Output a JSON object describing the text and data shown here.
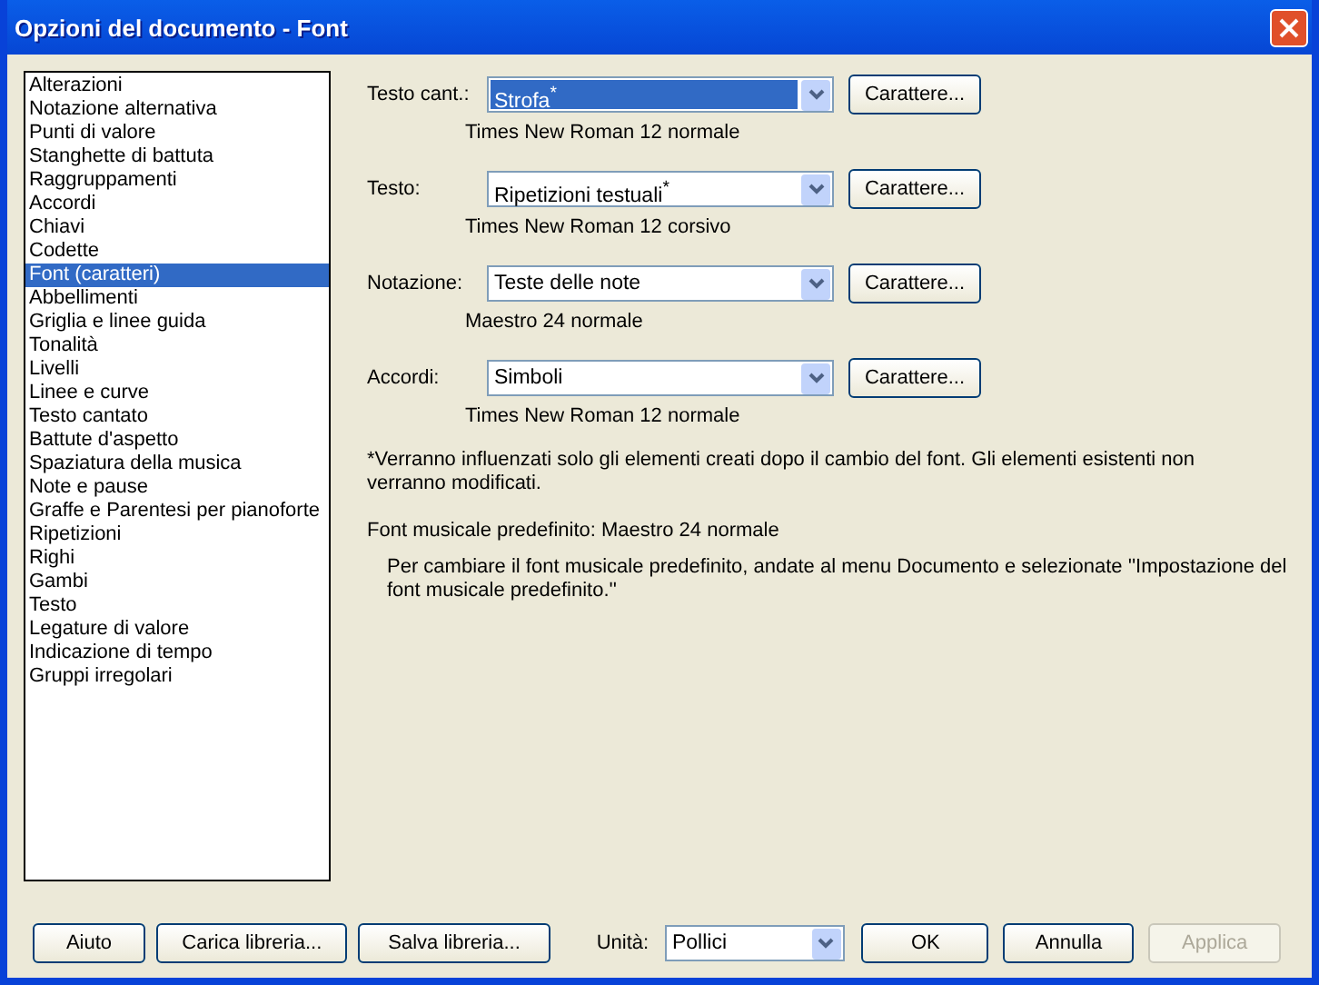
{
  "window": {
    "title": "Opzioni del documento - Font"
  },
  "sidebar": {
    "items": [
      {
        "label": "Alterazioni",
        "selected": false
      },
      {
        "label": "Notazione alternativa",
        "selected": false
      },
      {
        "label": "Punti di valore",
        "selected": false
      },
      {
        "label": "Stanghette di battuta",
        "selected": false
      },
      {
        "label": "Raggruppamenti",
        "selected": false
      },
      {
        "label": "Accordi",
        "selected": false
      },
      {
        "label": "Chiavi",
        "selected": false
      },
      {
        "label": "Codette",
        "selected": false
      },
      {
        "label": "Font (caratteri)",
        "selected": true
      },
      {
        "label": "Abbellimenti",
        "selected": false
      },
      {
        "label": "Griglia e linee guida",
        "selected": false
      },
      {
        "label": "Tonalità",
        "selected": false
      },
      {
        "label": "Livelli",
        "selected": false
      },
      {
        "label": "Linee e curve",
        "selected": false
      },
      {
        "label": "Testo cantato",
        "selected": false
      },
      {
        "label": "Battute d'aspetto",
        "selected": false
      },
      {
        "label": "Spaziatura della musica",
        "selected": false
      },
      {
        "label": "Note e pause",
        "selected": false
      },
      {
        "label": "Graffe e Parentesi per pianoforte",
        "selected": false
      },
      {
        "label": "Ripetizioni",
        "selected": false
      },
      {
        "label": "Righi",
        "selected": false
      },
      {
        "label": "Gambi",
        "selected": false
      },
      {
        "label": "Testo",
        "selected": false
      },
      {
        "label": "Legature di valore",
        "selected": false
      },
      {
        "label": "Indicazione di tempo",
        "selected": false
      },
      {
        "label": "Gruppi irregolari",
        "selected": false
      }
    ]
  },
  "font_rows": [
    {
      "label": "Testo cant.:",
      "value": "Strofa$^{*}$",
      "focused": true,
      "button": "Carattere...",
      "font": "Times New Roman 12 normale"
    },
    {
      "label": "Testo:",
      "value": "Ripetizioni testuali$^{*}$",
      "focused": false,
      "button": "Carattere...",
      "font": "Times New Roman 12 corsivo"
    },
    {
      "label": "Notazione:",
      "value": "Teste delle note",
      "focused": false,
      "button": "Carattere...",
      "font": "Maestro 24 normale"
    },
    {
      "label": "Accordi:",
      "value": "Simboli",
      "focused": false,
      "button": "Carattere...",
      "font": "Times New Roman 12 normale"
    }
  ],
  "note": "*Verranno influenzati solo gli elementi creati dopo il cambio del font. Gli elementi esistenti non verranno modificati.",
  "default_font": "Font musicale predefinito: Maestro 24 normale",
  "hint": "Per cambiare il font musicale predefinito, andate al menu Documento e selezionate ''Impostazione del font musicale predefinito.''",
  "footer": {
    "left_buttons": [
      {
        "label": "Aiuto",
        "disabled": false
      },
      {
        "label": "Carica libreria...",
        "disabled": false
      },
      {
        "label": "Salva libreria...",
        "disabled": false
      }
    ],
    "units_label": "Unità:",
    "units_value": "Pollici",
    "right_buttons": [
      {
        "label": "OK",
        "disabled": false
      },
      {
        "label": "Annulla",
        "disabled": false
      },
      {
        "label": "Applica",
        "disabled": true
      }
    ]
  }
}
